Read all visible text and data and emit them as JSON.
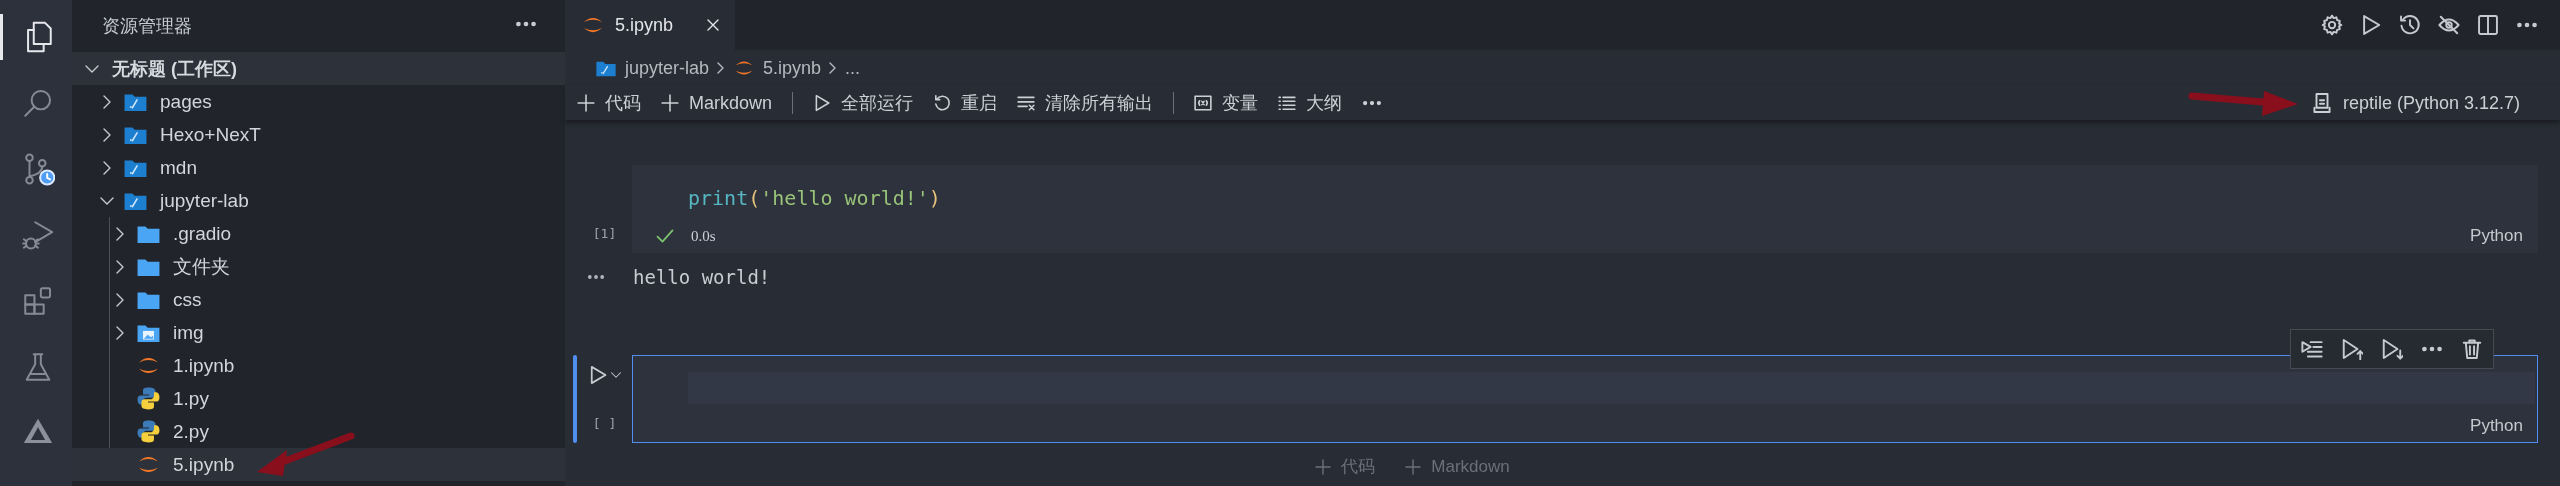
{
  "activity_bar": [
    {
      "kind": "explorer",
      "selected": true
    },
    {
      "kind": "search",
      "selected": false
    },
    {
      "kind": "source-control",
      "selected": false
    },
    {
      "kind": "run-debug",
      "selected": false
    },
    {
      "kind": "extensions",
      "selected": false
    },
    {
      "kind": "testing",
      "selected": false
    },
    {
      "kind": "other",
      "selected": false
    }
  ],
  "sidebar": {
    "title": "资源管理器",
    "workspace": {
      "label": "无标题 (工作区)",
      "expanded": true
    },
    "tree": [
      {
        "label": "pages",
        "kind": "workspace-folder",
        "expanded": false,
        "selected": false
      },
      {
        "label": "Hexo+NexT",
        "kind": "workspace-folder",
        "expanded": false,
        "selected": false
      },
      {
        "label": "mdn",
        "kind": "workspace-folder",
        "expanded": false,
        "selected": false
      },
      {
        "label": "jupyter-lab",
        "kind": "workspace-folder",
        "expanded": true,
        "selected": false,
        "children": [
          {
            "label": ".gradio",
            "kind": "folder",
            "expanded": false,
            "selected": false
          },
          {
            "label": "文件夹",
            "kind": "folder",
            "expanded": false,
            "selected": false
          },
          {
            "label": "css",
            "kind": "folder",
            "expanded": false,
            "selected": false
          },
          {
            "label": "img",
            "kind": "image-folder",
            "expanded": false,
            "selected": false
          },
          {
            "label": "1.ipynb",
            "kind": "notebook",
            "selected": false
          },
          {
            "label": "1.py",
            "kind": "python",
            "selected": false
          },
          {
            "label": "2.py",
            "kind": "python",
            "selected": false
          },
          {
            "label": "5.ipynb",
            "kind": "notebook",
            "selected": true
          }
        ]
      }
    ]
  },
  "editor": {
    "tabs": [
      {
        "label": "5.ipynb",
        "selected": true
      }
    ],
    "actions": [
      {
        "kind": "settings"
      },
      {
        "kind": "run"
      },
      {
        "kind": "history"
      },
      {
        "kind": "eye-off"
      },
      {
        "kind": "split"
      },
      {
        "kind": "more"
      }
    ],
    "breadcrumb": [
      {
        "label": "jupyter-lab",
        "kind": "workspace-folder"
      },
      {
        "label": "5.ipynb",
        "kind": "notebook"
      },
      {
        "label": "...",
        "kind": "text"
      }
    ],
    "toolbar": [
      {
        "label": "代码",
        "kind": "plus"
      },
      {
        "label": "Markdown",
        "kind": "plus"
      },
      {
        "kind": "separator"
      },
      {
        "label": "全部运行",
        "kind": "run"
      },
      {
        "label": "重启",
        "kind": "restart"
      },
      {
        "label": "清除所有输出",
        "kind": "clear"
      },
      {
        "kind": "separator"
      },
      {
        "label": "变量",
        "kind": "variables"
      },
      {
        "label": "大纲",
        "kind": "outline"
      },
      {
        "kind": "more"
      }
    ],
    "kernel": "reptile (Python 3.12.7)",
    "cells": [
      {
        "selected": false,
        "execution_count": "[1]",
        "code": [
          {
            "kind": "function",
            "text": "print"
          },
          {
            "kind": "paren",
            "text": "("
          },
          {
            "kind": "string",
            "text": "'hello world!'"
          },
          {
            "kind": "paren",
            "text": ")"
          }
        ],
        "succeeded": true,
        "duration": "0.0s",
        "language": "Python",
        "output": "hello world!"
      },
      {
        "selected": true,
        "execution_count": "[ ]",
        "succeeded": false,
        "language": "Python",
        "toolbar": [
          {
            "kind": "run-by-line"
          },
          {
            "kind": "run-above"
          },
          {
            "kind": "run-below"
          },
          {
            "kind": "more"
          },
          {
            "kind": "delete"
          }
        ]
      }
    ],
    "add_buttons": [
      "代码",
      "Markdown"
    ]
  }
}
